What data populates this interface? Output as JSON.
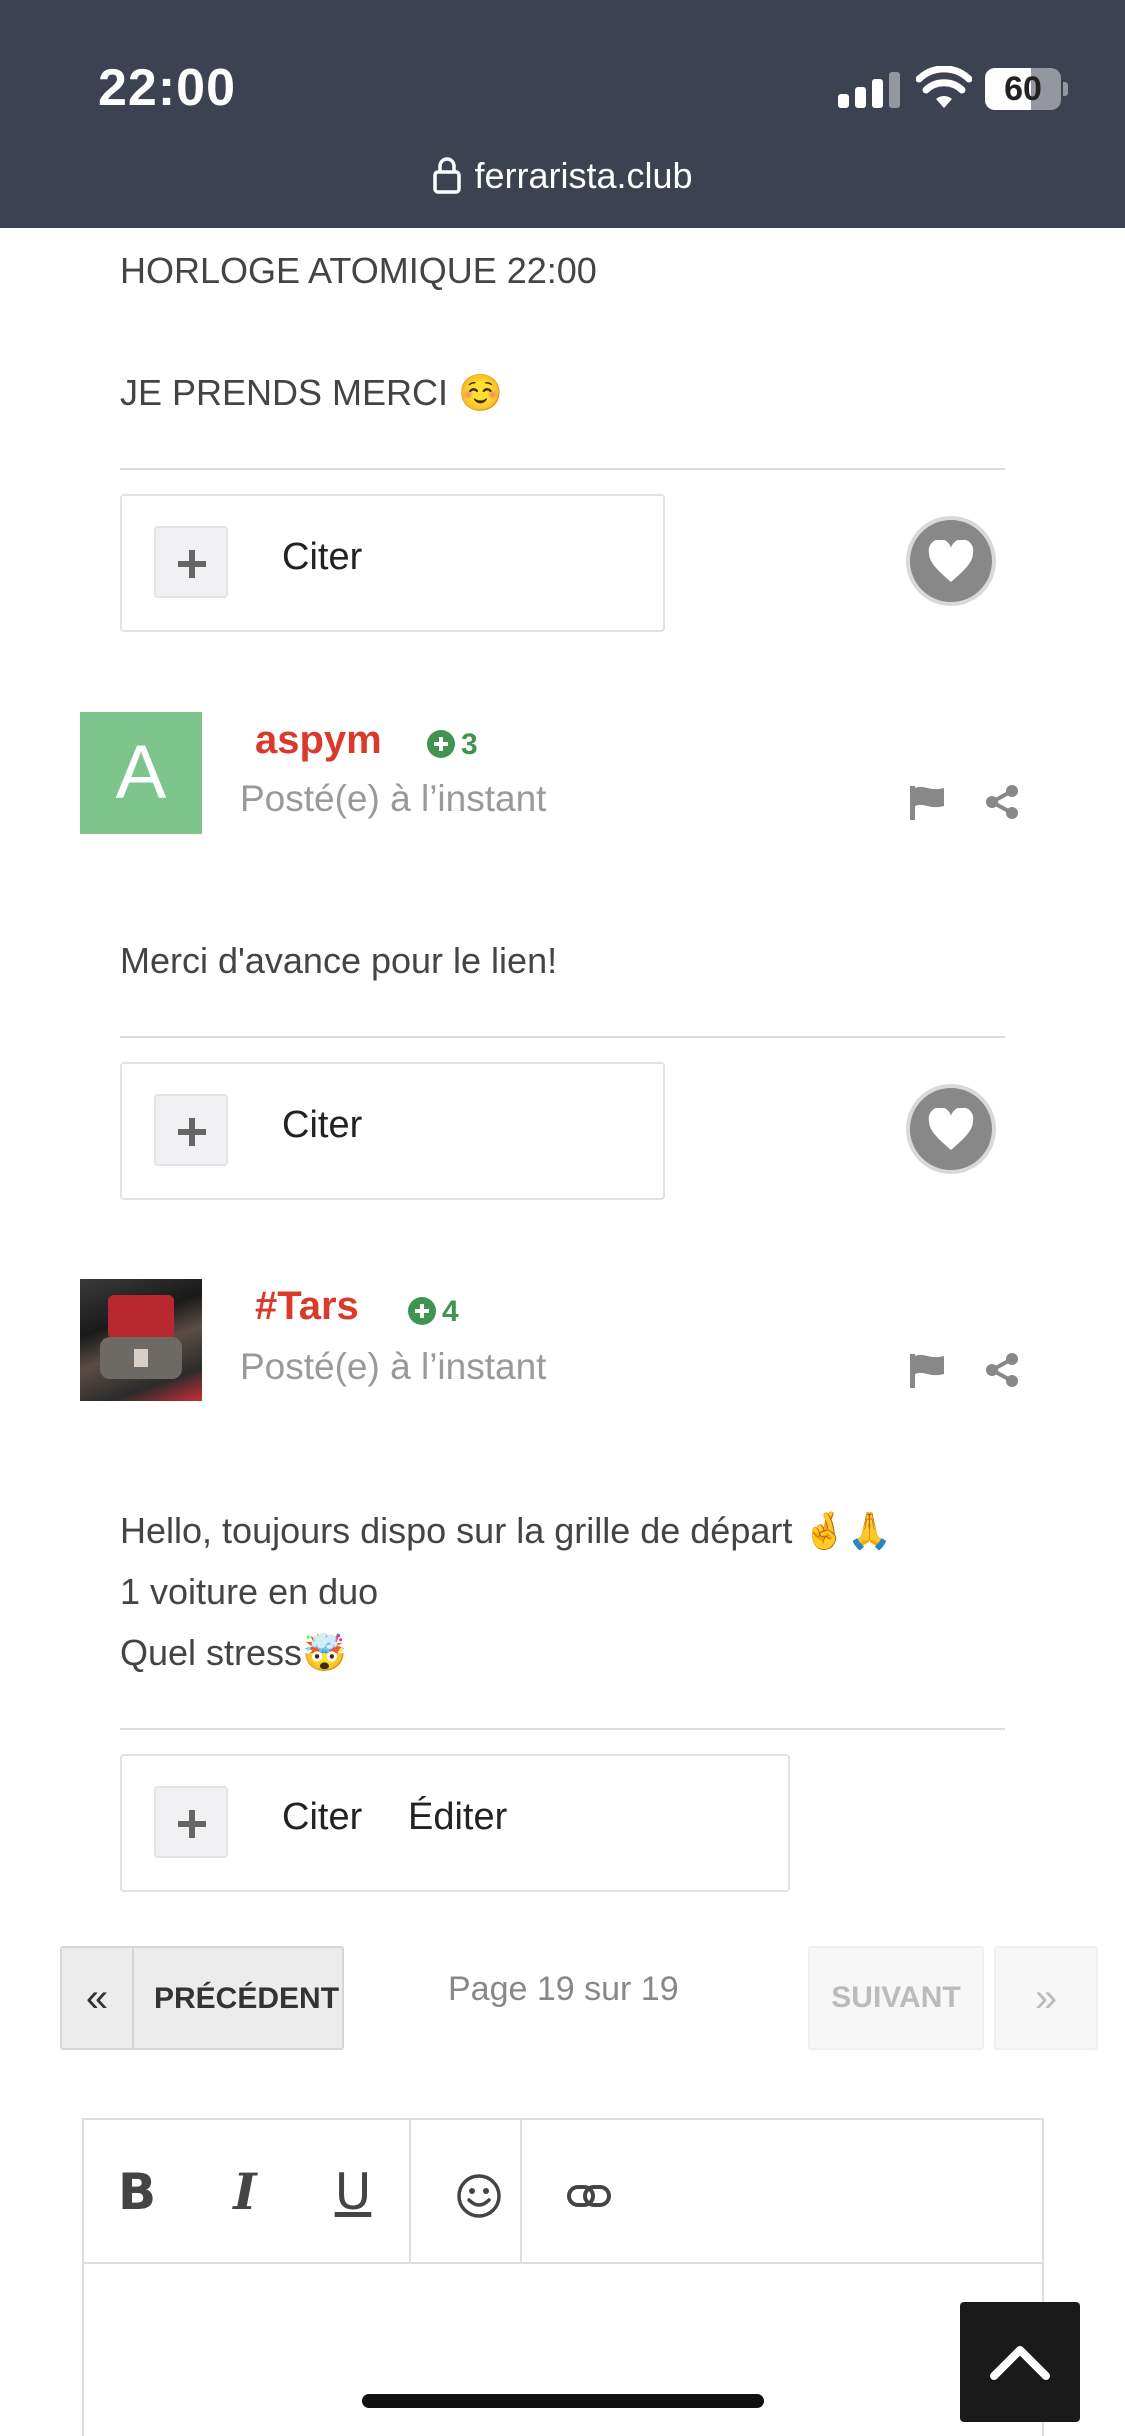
{
  "status_bar": {
    "time": "22:00",
    "battery": "60",
    "battery_level": 0.6
  },
  "browser": {
    "url": "ferrarista.club"
  },
  "posts": [
    {
      "lines": [
        "HORLOGE ATOMIQUE 22:00",
        "JE PRENDS MERCI ☺️"
      ],
      "actions": {
        "quote": "Citer"
      }
    },
    {
      "author": "aspym",
      "avatar_letter": "A",
      "reputation": "3",
      "posted": "Posté(e) à l’instant",
      "lines": [
        "Merci d'avance pour le lien!"
      ],
      "actions": {
        "quote": "Citer"
      }
    },
    {
      "author": "#Tars",
      "reputation": "4",
      "posted": "Posté(e) à l’instant",
      "lines": [
        "Hello, toujours dispo sur la grille de départ 🤞🙏",
        "1 voiture en duo",
        "Quel stress🤯"
      ],
      "actions": {
        "quote": "Citer",
        "edit": "Éditer"
      }
    }
  ],
  "pagination": {
    "first": "«",
    "prev": "PRÉCÉDENT",
    "info": "Page 19 sur 19",
    "next": "SUIVANT",
    "last": "»"
  },
  "editor": {
    "bold": "B",
    "italic": "I",
    "underline": "U"
  },
  "colors": {
    "header_bg": "#3d4252",
    "username": "#d93a2b",
    "reputation": "#3f9450",
    "avatar_letter_bg": "#7ec48d"
  },
  "icons": [
    "lock-icon",
    "signal-icon",
    "wifi-icon",
    "battery-icon",
    "plus-icon",
    "heart-icon",
    "flag-icon",
    "share-icon",
    "emoji-icon",
    "link-icon",
    "chevron-up-icon"
  ]
}
